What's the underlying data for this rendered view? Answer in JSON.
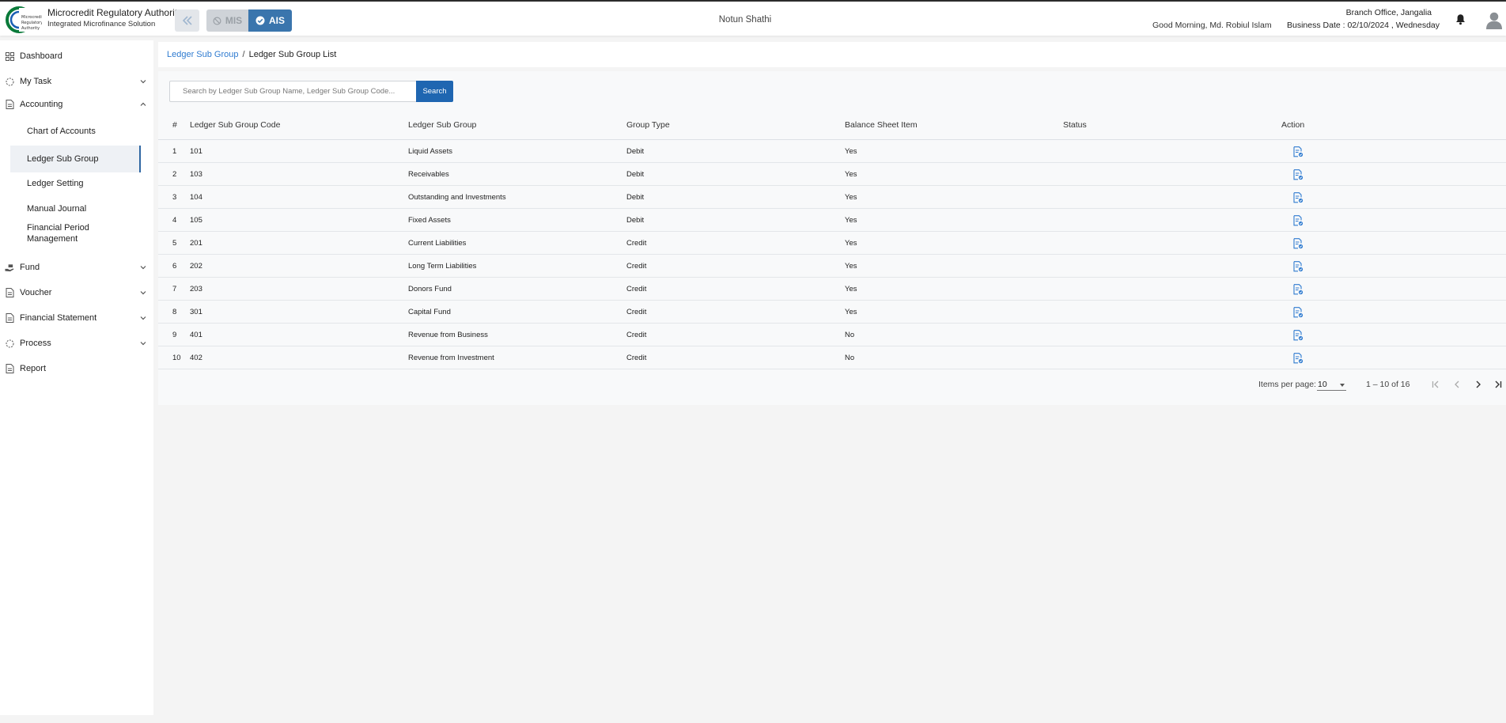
{
  "header": {
    "brand_title": "Microcredit Regulatory Authority",
    "brand_subtitle": "Integrated Microfinance Solution",
    "logo_text": "Microcredit Regulatory Authority",
    "modes": {
      "mis_label": "MIS",
      "ais_label": "AIS",
      "active": "AIS"
    },
    "org_name": "Notun Shathi",
    "greeting": "Good Morning, Md. Robiul Islam",
    "branch": "Branch Office, Jangalia",
    "business_date": "Business Date : 02/10/2024 , Wednesday"
  },
  "sidebar": {
    "items": [
      {
        "label": "Dashboard",
        "icon": "grid-icon"
      },
      {
        "label": "My Task",
        "icon": "circle-dashed-icon",
        "expandable": true
      },
      {
        "label": "Accounting",
        "icon": "document-icon",
        "expanded": true,
        "children": [
          {
            "label": "Chart of Accounts"
          },
          {
            "label": "Ledger Sub Group",
            "active": true
          },
          {
            "label": "Ledger Setting"
          },
          {
            "label": "Manual Journal"
          },
          {
            "label": "Financial Period Management"
          }
        ]
      },
      {
        "label": "Fund",
        "icon": "hand-money-icon",
        "expandable": true
      },
      {
        "label": "Voucher",
        "icon": "document-icon",
        "expandable": true
      },
      {
        "label": "Financial Statement",
        "icon": "document-icon",
        "expandable": true
      },
      {
        "label": "Process",
        "icon": "circle-dashed-icon",
        "expandable": true
      },
      {
        "label": "Report",
        "icon": "document-icon"
      }
    ]
  },
  "breadcrumb": {
    "parent": "Ledger Sub Group",
    "separator": "/",
    "current": "Ledger Sub Group List"
  },
  "search": {
    "placeholder": "Search by Ledger Sub Group Name, Ledger Sub Group Code...",
    "value": "",
    "button_label": "Search"
  },
  "table": {
    "columns": [
      "#",
      "Ledger Sub Group Code",
      "Ledger Sub Group",
      "Group Type",
      "Balance Sheet Item",
      "Status",
      "Action"
    ],
    "rows": [
      {
        "idx": "1",
        "code": "101",
        "group": "Liquid Assets",
        "type": "Debit",
        "bsi": "Yes",
        "status": ""
      },
      {
        "idx": "2",
        "code": "103",
        "group": "Receivables",
        "type": "Debit",
        "bsi": "Yes",
        "status": ""
      },
      {
        "idx": "3",
        "code": "104",
        "group": "Outstanding and Investments",
        "type": "Debit",
        "bsi": "Yes",
        "status": ""
      },
      {
        "idx": "4",
        "code": "105",
        "group": "Fixed Assets",
        "type": "Debit",
        "bsi": "Yes",
        "status": ""
      },
      {
        "idx": "5",
        "code": "201",
        "group": "Current Liabilities",
        "type": "Credit",
        "bsi": "Yes",
        "status": ""
      },
      {
        "idx": "6",
        "code": "202",
        "group": "Long Term Liabilities",
        "type": "Credit",
        "bsi": "Yes",
        "status": ""
      },
      {
        "idx": "7",
        "code": "203",
        "group": "Donors Fund",
        "type": "Credit",
        "bsi": "Yes",
        "status": ""
      },
      {
        "idx": "8",
        "code": "301",
        "group": "Capital Fund",
        "type": "Credit",
        "bsi": "Yes",
        "status": ""
      },
      {
        "idx": "9",
        "code": "401",
        "group": "Revenue from Business",
        "type": "Credit",
        "bsi": "No",
        "status": ""
      },
      {
        "idx": "10",
        "code": "402",
        "group": "Revenue from Investment",
        "type": "Credit",
        "bsi": "No",
        "status": ""
      }
    ],
    "action_icon": "edit-document-icon"
  },
  "paginator": {
    "items_per_page_label": "Items per page:",
    "items_per_page": "10",
    "range_label": "1 – 10 of 16"
  },
  "colors": {
    "accent": "#1f66b1",
    "link": "#2f7bd0",
    "ais_active": "#3a75ad",
    "mis_inactive": "#cfd3d8",
    "active_indicator": "#2f67a3"
  }
}
